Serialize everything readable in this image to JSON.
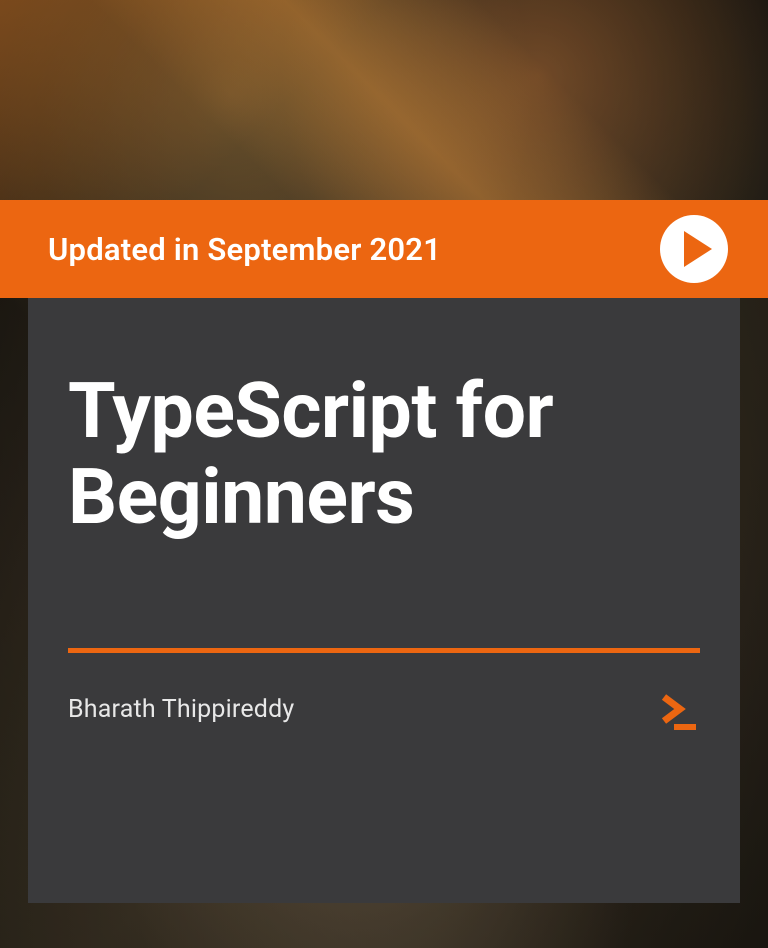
{
  "header": {
    "update_text": "Updated in September 2021"
  },
  "main": {
    "title": "TypeScript for Beginners",
    "author": "Bharath Thippireddy"
  },
  "colors": {
    "accent": "#ec6611",
    "panel": "#3a3a3c"
  }
}
